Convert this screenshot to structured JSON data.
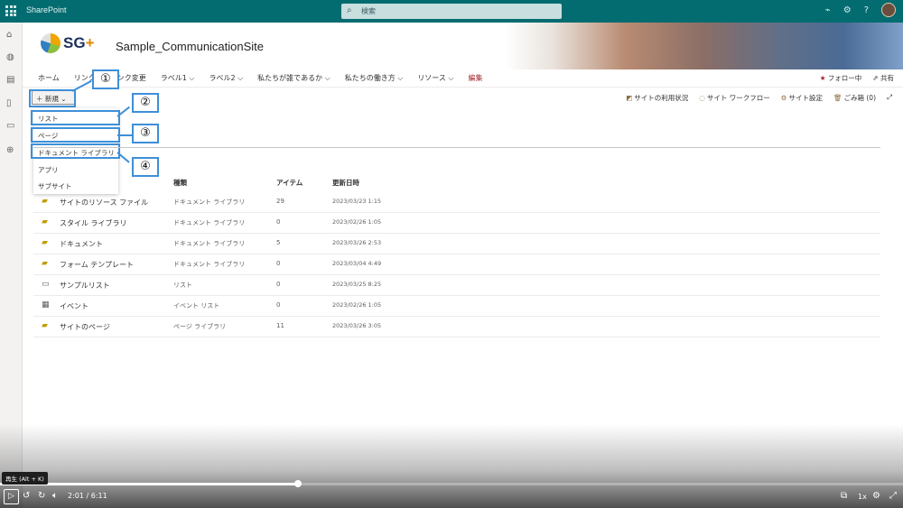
{
  "app": {
    "brand": "SharePoint",
    "search_placeholder": "検索"
  },
  "site": {
    "logo_text": "SG",
    "logo_plus": "+",
    "title": "Sample_CommunicationSite"
  },
  "nav": {
    "items": [
      "ホーム",
      "リンク",
      "リンク変更",
      "ラベル1 ⌵",
      "ラベル2 ⌵",
      "私たちが誰であるか ⌵",
      "私たちの働き方 ⌵",
      "リソース ⌵"
    ],
    "edit_label": "編集",
    "follow_label": "フォロー中",
    "share_label": "共有"
  },
  "commandbar": {
    "new_label": "新規",
    "site_usage": "サイトの利用状況",
    "site_workflow": "サイト ワークフロー",
    "site_settings": "サイト設定",
    "recycle_bin": "ごみ箱 (0)"
  },
  "new_menu": {
    "items": [
      "リスト",
      "ページ",
      "ドキュメント ライブラリ",
      "アプリ",
      "サブサイト"
    ]
  },
  "callouts": [
    "①",
    "②",
    "③",
    "④"
  ],
  "table": {
    "headers": {
      "type": "種類",
      "items": "アイテム",
      "modified": "更新日時"
    },
    "rows": [
      {
        "name": "サイトのリソース ファイル",
        "type": "ドキュメント ライブラリ",
        "items": "29",
        "modified": "2023/03/23 1:15",
        "icon": "library-icon"
      },
      {
        "name": "スタイル ライブラリ",
        "type": "ドキュメント ライブラリ",
        "items": "0",
        "modified": "2023/02/26 1:05",
        "icon": "library-icon"
      },
      {
        "name": "ドキュメント",
        "type": "ドキュメント ライブラリ",
        "items": "5",
        "modified": "2023/03/26 2:53",
        "icon": "library-icon"
      },
      {
        "name": "フォーム テンプレート",
        "type": "ドキュメント ライブラリ",
        "items": "0",
        "modified": "2023/03/04 4:49",
        "icon": "library-icon"
      },
      {
        "name": "サンプルリスト",
        "type": "リスト",
        "items": "0",
        "modified": "2023/03/25 8:25",
        "icon": "list-icon"
      },
      {
        "name": "イベント",
        "type": "イベント リスト",
        "items": "0",
        "modified": "2023/02/26 1:05",
        "icon": "calendar-icon"
      },
      {
        "name": "サイトのページ",
        "type": "ページ ライブラリ",
        "items": "11",
        "modified": "2023/03/26 3:05",
        "icon": "library-icon"
      }
    ]
  },
  "player": {
    "tooltip": "再生 (Alt + K)",
    "time": "2:01 / 6:11",
    "speed": "1x",
    "progress_fraction": 0.33
  },
  "colors": {
    "suite_bar": "#036c70",
    "callout_border": "#3e8fd8",
    "edit_text": "#a4262c"
  }
}
